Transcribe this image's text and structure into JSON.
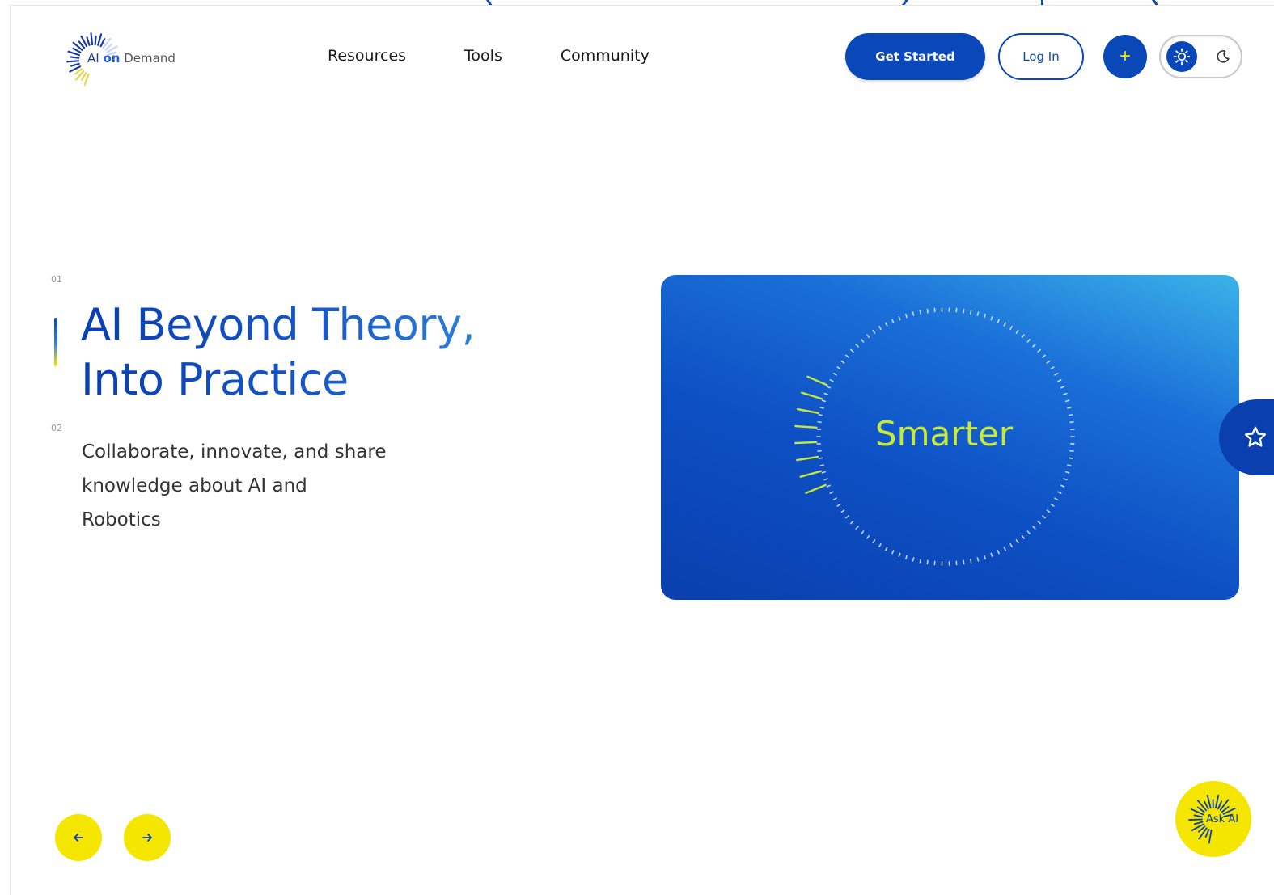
{
  "brand": {
    "logo_part1": "AI",
    "logo_part2": "on",
    "logo_part3": "Demand"
  },
  "nav": {
    "items": [
      {
        "label": "Resources"
      },
      {
        "label": "Tools"
      },
      {
        "label": "Community"
      }
    ]
  },
  "header": {
    "get_started_label": "Get Started",
    "login_label": "Log In",
    "plus_label": "+"
  },
  "hero": {
    "slide_1_number": "01",
    "slide_2_number": "02",
    "title_line1": "AI Beyond Theory,",
    "title_line2": "Into Practice",
    "subtitle": "Collaborate, innovate, and share knowledge about AI and Robotics",
    "card_word": "Smarter"
  },
  "ask_ai": {
    "label": "Ask AI"
  },
  "colors": {
    "primary": "#0a47b8",
    "accent_yellow": "#f4e600",
    "card_highlight": "#c8e83a"
  },
  "icons": {
    "theme_light": "sun-icon",
    "theme_dark": "moon-icon",
    "bookmark": "star-icon",
    "prev": "arrow-left-icon",
    "next": "arrow-right-icon"
  }
}
